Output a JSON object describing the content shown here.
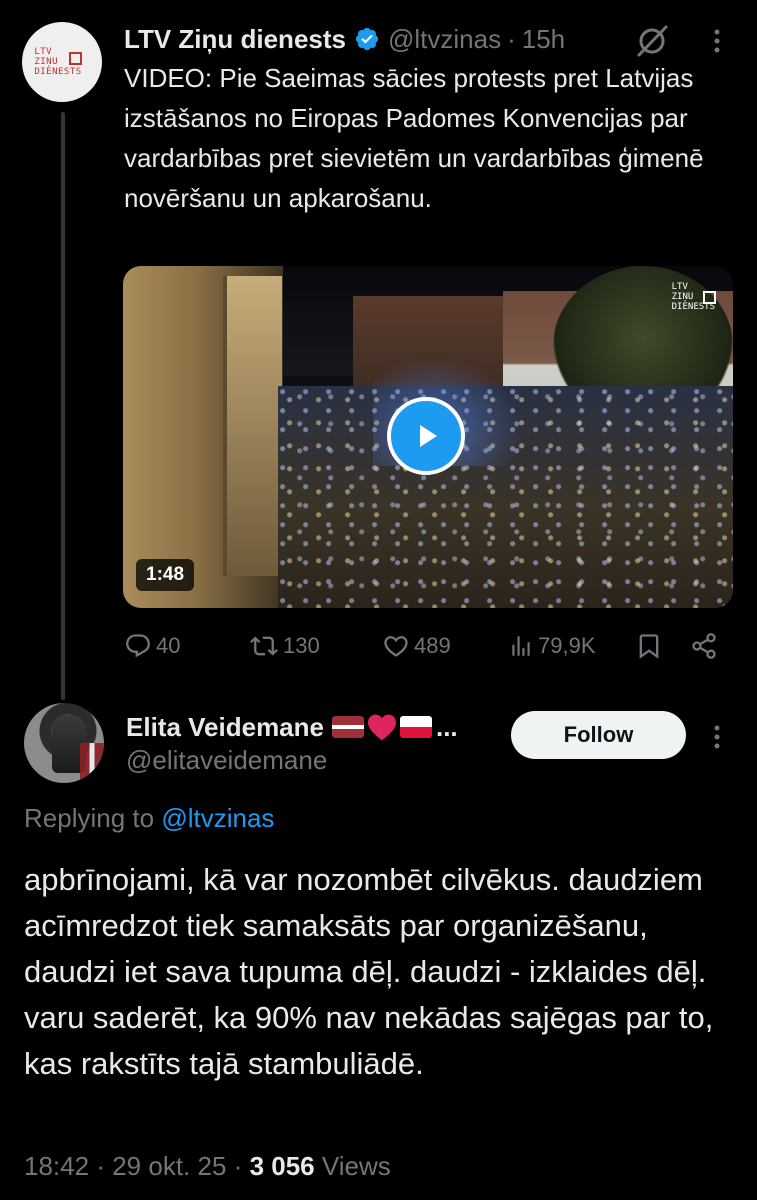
{
  "parent_tweet": {
    "author": {
      "display_name": "LTV Ziņu dienests",
      "handle": "@ltvzinas",
      "avatar_logo_lines": [
        "LTV",
        "ZIŅU",
        "DIENESTS"
      ],
      "verified": true
    },
    "separator": "·",
    "time": "15h",
    "text": "VIDEO: Pie Saeimas sācies protests pret Latvijas izstāšanos no Eiropas Padomes Konvencijas par vardarbības pret sievietēm un vardarbības ģimenē novēršanu un apkarošanu.",
    "video": {
      "duration": "1:48",
      "watermark_lines": [
        "LTV",
        "ZIŅU",
        "DIENESTS"
      ]
    },
    "actions": {
      "replies": "40",
      "reposts": "130",
      "likes": "489",
      "views": "79,9K"
    },
    "icons": [
      "verified-icon",
      "grok-icon",
      "more-icon",
      "play-icon",
      "reply-icon",
      "repost-icon",
      "like-icon",
      "views-icon",
      "bookmark-icon",
      "share-icon"
    ]
  },
  "reply_tweet": {
    "author": {
      "display_name": "Elita Veidemane",
      "handle": "@elitaveidemane",
      "name_ellipsis": "..."
    },
    "follow_label": "Follow",
    "replying_to": {
      "label": "Replying to",
      "handle": "@ltvzinas"
    },
    "text": "apbrīnojami, kā var nozombēt cilvēkus. daudziem acīmredzot tiek samaksāts par organizēšanu, daudzi iet sava tupuma dēļ. daudzi - izklaides dēļ. varu saderēt, ka 90% nav nekādas sajēgas par to, kas rakstīts tajā stambuliādē.",
    "meta": {
      "time": "18:42",
      "date": "29 okt. 25",
      "separator": "·",
      "views_count": "3 056",
      "views_label": "Views"
    }
  },
  "colors": {
    "background": "#000000",
    "primary_text": "#e7e9ea",
    "secondary_text": "#71767b",
    "accent": "#1d9bf0",
    "follow_button_bg": "#eff3f4",
    "thread_line": "#333639"
  }
}
